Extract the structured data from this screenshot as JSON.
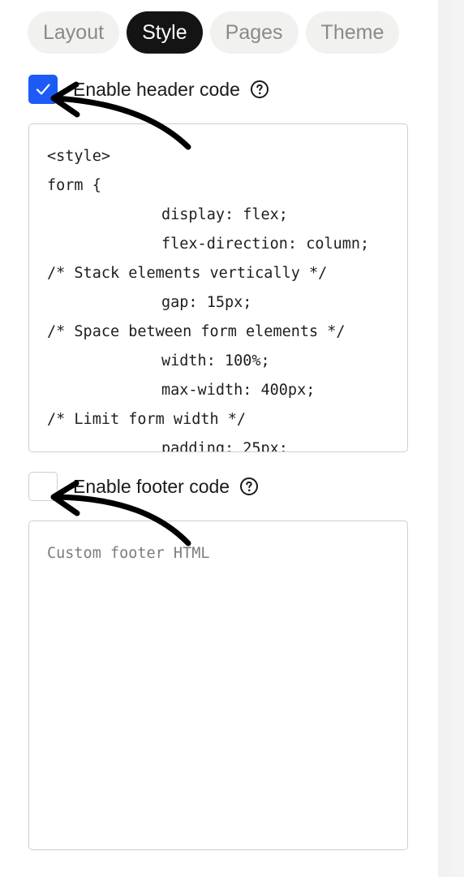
{
  "tabs": [
    {
      "label": "Layout",
      "active": false
    },
    {
      "label": "Style",
      "active": true
    },
    {
      "label": "Pages",
      "active": false
    },
    {
      "label": "Theme",
      "active": false
    }
  ],
  "header_code": {
    "label": "Enable header code",
    "checked": true,
    "help_icon": "question-circle-icon",
    "lines": [
      "<style>",
      "form {",
      "display: flex;",
      "flex-direction: column;",
      "/* Stack elements vertically */",
      "gap: 15px;",
      "/* Space between form elements */",
      "width: 100%;",
      "max-width: 400px;",
      "/* Limit form width */",
      "padding: 25px;"
    ]
  },
  "footer_code": {
    "label": "Enable footer code",
    "checked": false,
    "help_icon": "question-circle-icon",
    "placeholder": "Custom footer HTML",
    "value": ""
  },
  "colors": {
    "accent": "#1c5bf5",
    "active_tab": "#141414"
  }
}
